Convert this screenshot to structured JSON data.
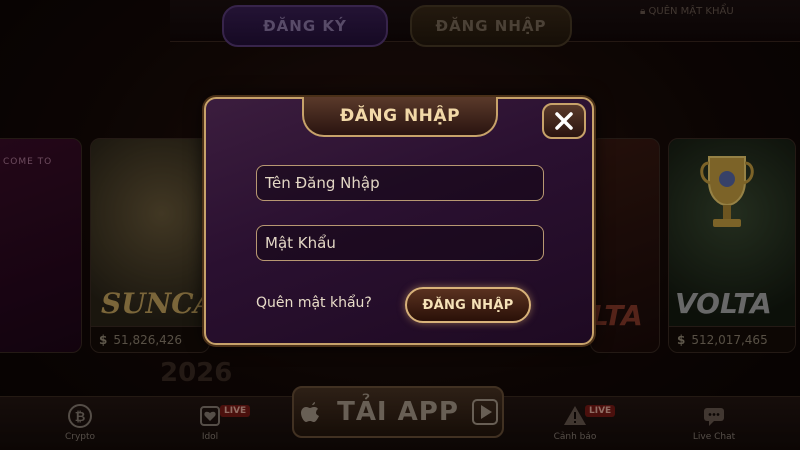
{
  "top_bar": {
    "register_label": "ĐĂNG KÝ",
    "login_label": "ĐĂNG NHẬP",
    "forgot_label": "QUÊN MẬT KHẨU"
  },
  "cards": {
    "left_welcome": "COME TO",
    "sun_logo": "SUNCA",
    "sun_jackpot": "51,826,426",
    "mid_logo": "LTA",
    "volta_logo": "VOLTA",
    "volta_jackpot": "512,017,465",
    "jackpot_symbol": "$"
  },
  "background_year": "2026",
  "bottom_bar": {
    "items": [
      {
        "label": "Crypto",
        "icon": "bitcoin-icon"
      },
      {
        "label": "Idol",
        "icon": "heart-card-icon",
        "badge": "LIVE"
      },
      {
        "label": "Cảnh báo",
        "icon": "warning-icon",
        "badge": "LIVE"
      },
      {
        "label": "Live Chat",
        "icon": "chat-icon"
      }
    ],
    "download_label": "TẢI APP"
  },
  "modal": {
    "title": "ĐĂNG NHẬP",
    "username_placeholder": "Tên Đăng Nhập",
    "password_placeholder": "Mật Khẩu",
    "forgot_password": "Quên mật khẩu?",
    "submit_label": "ĐĂNG NHẬP"
  },
  "colors": {
    "gold_border": "#c7a26a",
    "modal_bg": "#2a1030",
    "text_light": "#e8dcc8"
  }
}
